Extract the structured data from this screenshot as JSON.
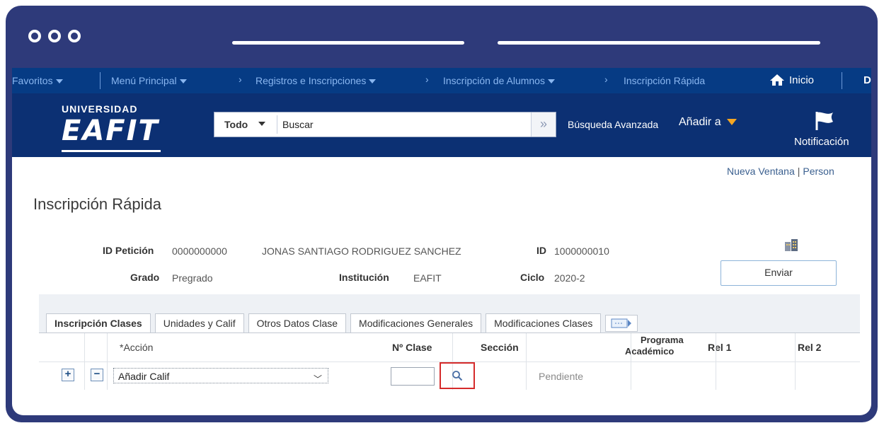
{
  "navbar": {
    "items": [
      "Favoritos",
      "Menú Principal",
      "Registros e Inscripciones",
      "Inscripción de Alumnos",
      "Inscripción Rápida"
    ],
    "home_label": "Inicio",
    "edge_letter": "D"
  },
  "header": {
    "logo_top": "UNIVERSIDAD",
    "logo_main": "EAFIT",
    "search_category": "Todo",
    "search_placeholder": "Buscar",
    "advanced_search": "Búsqueda Avanzada",
    "add_to": "Añadir a",
    "notifications": "Notificación"
  },
  "links": {
    "new_window": "Nueva Ventana",
    "personalize": "Person"
  },
  "page": {
    "title": "Inscripción Rápida",
    "id_peticion_label": "ID Petición",
    "id_peticion_value": "0000000000",
    "student_name": "JONAS SANTIAGO RODRIGUEZ SANCHEZ",
    "id_label": "ID",
    "id_value": "1000000010",
    "grado_label": "Grado",
    "grado_value": "Pregrado",
    "institucion_label": "Institución",
    "institucion_value": "EAFIT",
    "ciclo_label": "Ciclo",
    "ciclo_value": "2020-2",
    "submit": "Enviar"
  },
  "tabs": [
    "Inscripción Clases",
    "Unidades y Calif",
    "Otros Datos Clase",
    "Modificaciones Generales",
    "Modificaciones Clases"
  ],
  "table": {
    "headers": {
      "accion": "*Acción",
      "n_clase": "Nº Clase",
      "seccion": "Sección",
      "programa_1": "Programa",
      "programa_2": "Académico",
      "rel1": "Rel 1",
      "rel2": "Rel 2"
    },
    "row": {
      "accion_value": "Añadir Calif",
      "status": "Pendiente",
      "add_symbol": "+",
      "remove_symbol": "−"
    }
  },
  "colors": {
    "frame": "#2e3a7a",
    "navbar": "#063b84",
    "header": "#0c3073",
    "highlight": "#d52b2b",
    "accent": "#f5a622"
  }
}
